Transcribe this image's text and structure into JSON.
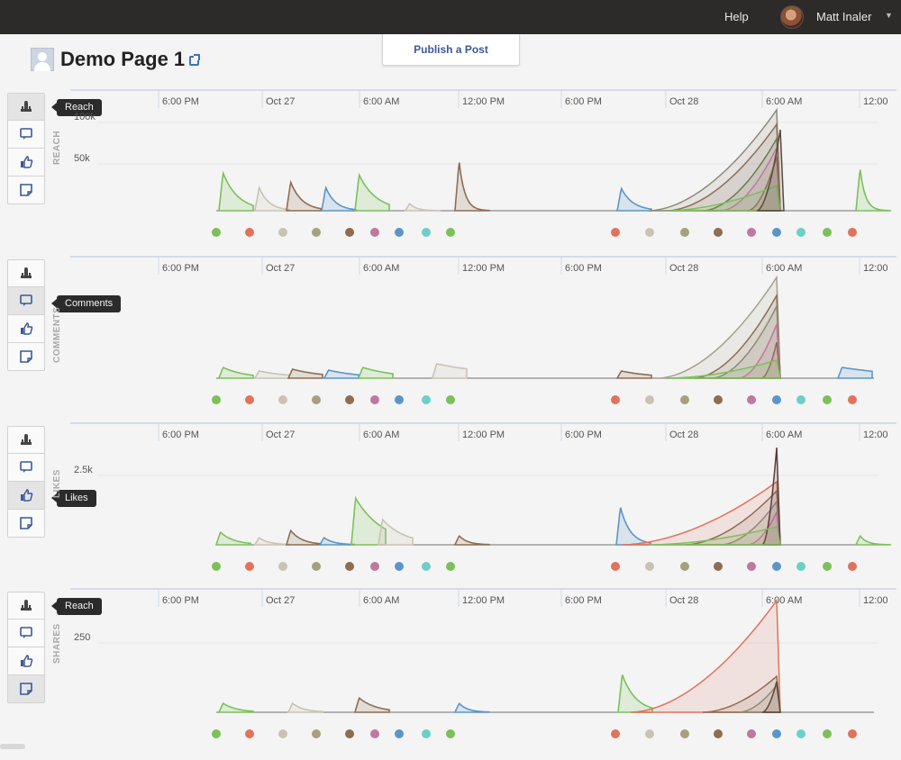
{
  "topbar": {
    "help": "Help",
    "user_name": "Matt Inaler"
  },
  "publish_button": "Publish a Post",
  "page": {
    "title": "Demo Page 1"
  },
  "icons": [
    "reach-icon",
    "comments-icon",
    "likes-icon",
    "shares-icon"
  ],
  "time_ticks": [
    "6:00 PM",
    "Oct 27",
    "6:00 AM",
    "12:00 PM",
    "6:00 PM",
    "Oct 28",
    "6:00 AM",
    "12:00"
  ],
  "colors": {
    "accent": "#3b5998",
    "posts": [
      "#7cc05a",
      "#e0735c",
      "#c9c3b2",
      "#a6a07e",
      "#8e6d52",
      "#c0789e",
      "#5c95c8",
      "#6ccfc8",
      "#7cc05a",
      "#e0735c",
      "#c9c3b2",
      "#a6a07e",
      "#8e6d52",
      "#c0789e",
      "#5c95c8",
      "#6ccfc8",
      "#7cc05a",
      "#e0735c"
    ]
  },
  "chart_data": [
    {
      "type": "area",
      "metric": "REACH",
      "tooltip": "Reach",
      "x_labels": [
        "6:00 PM",
        "Oct 27",
        "6:00 AM",
        "12:00 PM",
        "6:00 PM",
        "Oct 28",
        "6:00 AM",
        "12:00"
      ],
      "y_ticks": [
        "100k",
        "50k"
      ],
      "peaks": [
        40000,
        14000,
        22000,
        18000,
        28000,
        3000,
        5000,
        0,
        38000,
        14000,
        0,
        0,
        0,
        0,
        0,
        0,
        0,
        32000
      ],
      "late_curve_max": 110000
    },
    {
      "type": "area",
      "metric": "COMMENTS",
      "tooltip": "Comments",
      "x_labels": [
        "6:00 PM",
        "Oct 27",
        "6:00 AM",
        "12:00 PM",
        "6:00 PM",
        "Oct 28",
        "6:00 AM",
        "12:00"
      ],
      "y_ticks": []
    },
    {
      "type": "area",
      "metric": "LIKES",
      "tooltip": "Likes",
      "x_labels": [
        "6:00 PM",
        "Oct 27",
        "6:00 AM",
        "12:00 PM",
        "6:00 PM",
        "Oct 28",
        "6:00 AM",
        "12:00"
      ],
      "y_ticks": [
        "2.5k"
      ]
    },
    {
      "type": "area",
      "metric": "SHARES",
      "tooltip": "Reach",
      "x_labels": [
        "6:00 PM",
        "Oct 27",
        "6:00 AM",
        "12:00 PM",
        "6:00 PM",
        "Oct 28",
        "6:00 AM",
        "12:00"
      ],
      "y_ticks": [
        "250"
      ]
    }
  ]
}
